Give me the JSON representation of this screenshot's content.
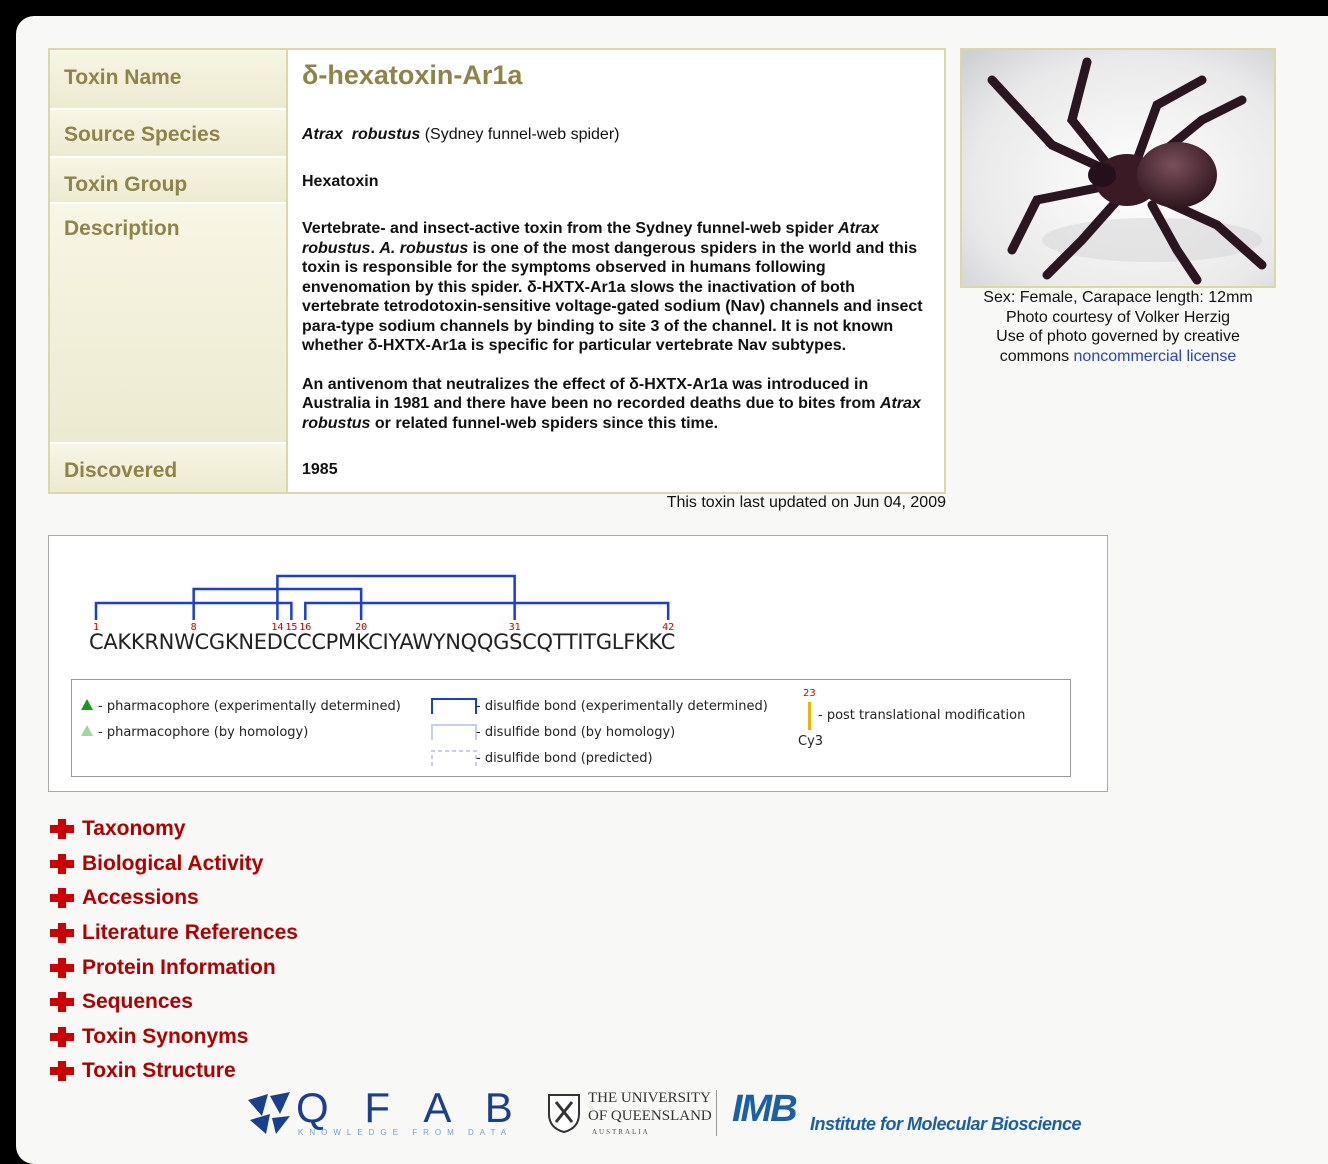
{
  "toxin": {
    "labels": {
      "name": "Toxin Name",
      "species": "Source Species",
      "group": "Toxin Group",
      "description": "Description",
      "discovered": "Discovered"
    },
    "name": "δ-hexatoxin-Ar1a",
    "species_genus": "Atrax",
    "species_epithet": "robustus",
    "species_common": "(Sydney funnel-web spider)",
    "group": "Hexatoxin",
    "description_p1_a": "Vertebrate- and insect-active toxin from the Sydney funnel-web spider ",
    "description_p1_i1": "Atrax robustus",
    "description_p1_b": ". ",
    "description_p1_i2": "A. robustus",
    "description_p1_c": " is one of the most dangerous spiders in the world and this toxin is responsible for the symptoms observed in humans following envenomation by this spider. δ-HXTX-Ar1a slows the inactivation of both vertebrate tetrodotoxin-sensitive voltage-gated sodium (Nav) channels and insect para-type sodium channels by binding to site 3 of the channel. It is not known whether δ-HXTX-Ar1a is specific for particular vertebrate Nav subtypes.",
    "description_p2_a": "An antivenom that neutralizes the effect of δ-HXTX-Ar1a was introduced in Australia in 1981 and there have been no recorded deaths due to bites from ",
    "description_p2_i": "Atrax robustus",
    "description_p2_b": " or related funnel-web spiders since this time.",
    "discovered": "1985",
    "updated": "This toxin last updated on Jun 04, 2009"
  },
  "photo": {
    "caption_1": "Sex: Female, Carapace length: 12mm",
    "caption_2": "Photo courtesy of Volker Herzig",
    "caption_3": "Use of photo governed by creative",
    "caption_4": "commons ",
    "license_link": "noncommercial license"
  },
  "sequence": {
    "residues": "CAKKRNWCGKNEDCCCPMKCIYAWYNQQGSCQTTITGLFKKC",
    "cys_positions": [
      "1",
      "8",
      "14",
      "15",
      "16",
      "20",
      "31",
      "42"
    ],
    "bonds": [
      [
        1,
        15
      ],
      [
        8,
        20
      ],
      [
        14,
        31
      ],
      [
        16,
        42
      ]
    ],
    "legend": {
      "pharm_exp": "- pharmacophore (experimentally determined)",
      "pharm_hom": "- pharmacophore (by homology)",
      "ds_exp": "- disulfide bond (experimentally determined)",
      "ds_hom": "- disulfide bond (by homology)",
      "ds_pred": "- disulfide bond (predicted)",
      "ptm_pos": "23",
      "ptm_label": "- post translational modification",
      "ptm_residue": "Cy3"
    }
  },
  "sections": [
    "Taxonomy",
    "Biological Activity",
    "Accessions",
    "Literature References",
    "Protein Information",
    "Sequences",
    "Toxin Synonyms",
    "Toxin Structure"
  ],
  "footer": {
    "qfab_letters": "Q F A B",
    "qfab_tagline": "KNOWLEDGE FROM DATA",
    "uq_line1": "THE UNIVERSITY",
    "uq_line2": "OF QUEENSLAND",
    "uq_line3": "AUSTRALIA",
    "imb_abbr": "IMB",
    "imb_name": "Institute for Molecular Bioscience"
  },
  "colors": {
    "label_text": "#8e8448",
    "section_red": "#b00000",
    "bond_exp": "#1a3fd0",
    "residue_num": "#cc0000"
  }
}
